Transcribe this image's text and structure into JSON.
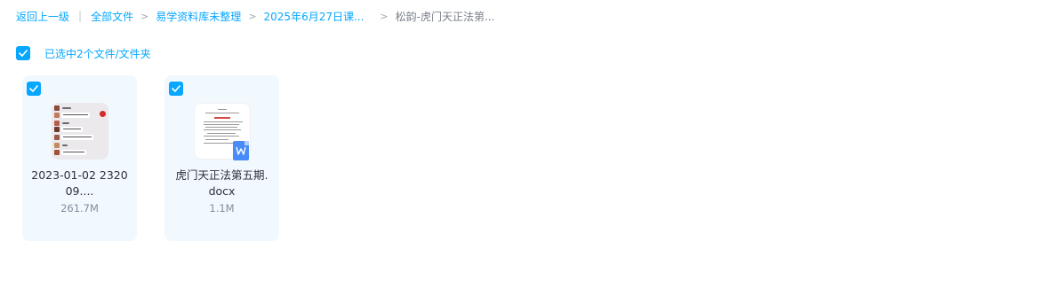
{
  "breadcrumb": {
    "back": "返回上一级",
    "items": [
      "全部文件",
      "易学资料库未整理",
      "2025年6月27日课...",
      "松韵-虎门天正法第..."
    ]
  },
  "selection": {
    "text": "已选中2个文件/文件夹"
  },
  "files": [
    {
      "name": "2023-01-02 2320 09....",
      "size": "261.7M",
      "type": "video"
    },
    {
      "name": "虎门天正法第五期. docx",
      "size": "1.1M",
      "type": "word"
    }
  ],
  "icons": {
    "checkbox": "check-icon",
    "word": "word-doc-icon"
  },
  "colors": {
    "accent": "#06a7ff",
    "card_bg": "#f1f8fe",
    "word_blue": "#4a8cf7"
  }
}
